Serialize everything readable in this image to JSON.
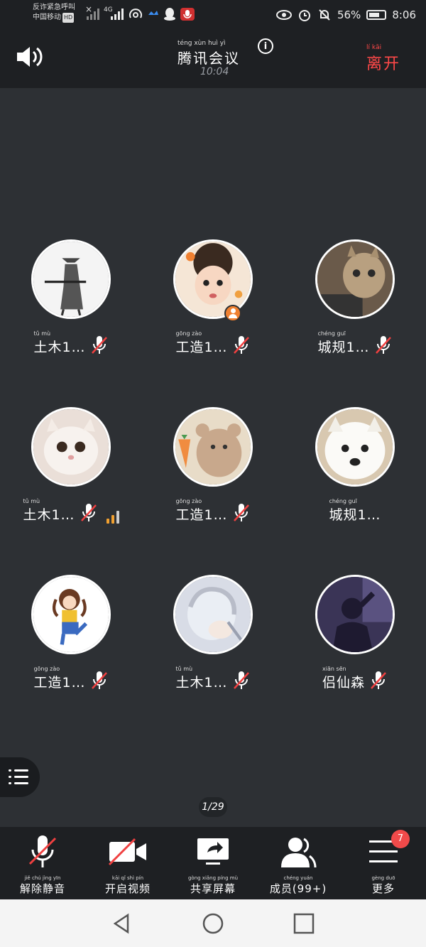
{
  "status_bar": {
    "carrier_line1": "反诈紧急呼叫",
    "carrier_line2": "中国移动",
    "hd": "HD",
    "network": "4G",
    "battery": "56%",
    "clock": "8:06"
  },
  "header": {
    "title": "腾讯会议",
    "title_pinyin": "téng xùn huì yì",
    "duration": "10:04",
    "leave_label": "离开",
    "leave_pinyin": "lí kāi"
  },
  "participants": [
    {
      "name": "土木1…",
      "pinyin": "tǔ mù",
      "muted": true
    },
    {
      "name": "工造1…",
      "pinyin": "gōng zào",
      "muted": true,
      "host": true
    },
    {
      "name": "城规1…",
      "pinyin": "chéng guī",
      "muted": true
    },
    {
      "name": "土木1…",
      "pinyin": "tǔ mù",
      "muted": true,
      "speaking": true
    },
    {
      "name": "工造1…",
      "pinyin": "gōng zào",
      "muted": true
    },
    {
      "name": "城规1…",
      "pinyin": "chéng guī",
      "muted": false
    },
    {
      "name": "工造1…",
      "pinyin": "gōng zào",
      "muted": true
    },
    {
      "name": "土木1…",
      "pinyin": "tǔ mù",
      "muted": true
    },
    {
      "name": "侣仙森",
      "pinyin": "xiān sēn",
      "muted": true
    }
  ],
  "pager": "1/29",
  "toolbar": {
    "unmute": {
      "label": "解除静音",
      "pinyin": "jiě chú jìng yīn"
    },
    "video": {
      "label": "开启视频",
      "pinyin": "kāi qǐ shì pín"
    },
    "share": {
      "label": "共享屏幕",
      "pinyin": "gòng xiǎng píng mù"
    },
    "members": {
      "label": "成员(99+)",
      "pinyin": "chéng yuán"
    },
    "more": {
      "label": "更多",
      "pinyin": "gèng duō",
      "badge": "7"
    }
  }
}
